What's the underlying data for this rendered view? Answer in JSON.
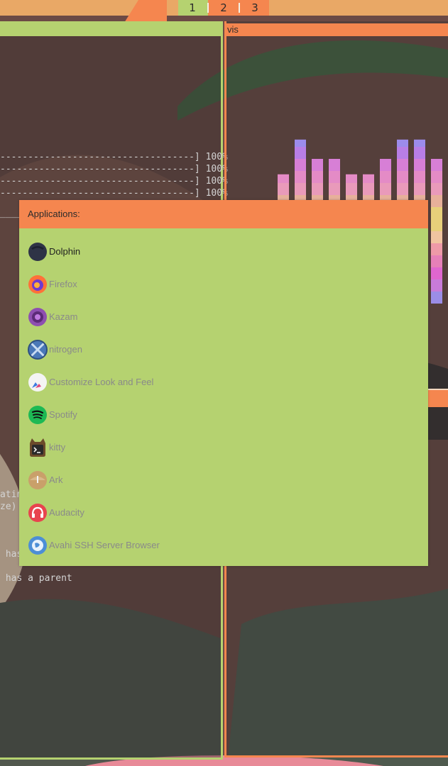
{
  "workspaces": [
    {
      "label": "1",
      "active": true
    },
    {
      "label": "2",
      "active": false
    },
    {
      "label": "3",
      "active": false
    }
  ],
  "right_window": {
    "title": "vis"
  },
  "terminal": {
    "lines": [
      "-----------------------------------] 100%",
      "-----------------------------------] 100%",
      "-----------------------------------] 100%",
      "-----------------------------------] 100%",
      "____",
      "atin",
      "ze)",
      " has",
      " has a parent"
    ]
  },
  "launcher": {
    "header": "Applications:",
    "items": [
      {
        "label": "Dolphin",
        "icon": "dolphin-icon",
        "selected": true
      },
      {
        "label": "Firefox",
        "icon": "firefox-icon",
        "selected": false
      },
      {
        "label": "Kazam",
        "icon": "kazam-icon",
        "selected": false
      },
      {
        "label": "nitrogen",
        "icon": "nitrogen-icon",
        "selected": false
      },
      {
        "label": "Customize Look and Feel",
        "icon": "customize-look-icon",
        "selected": false
      },
      {
        "label": "Spotify",
        "icon": "spotify-icon",
        "selected": false
      },
      {
        "label": "kitty",
        "icon": "kitty-icon",
        "selected": false
      },
      {
        "label": "Ark",
        "icon": "ark-icon",
        "selected": false
      },
      {
        "label": "Audacity",
        "icon": "audacity-icon",
        "selected": false
      },
      {
        "label": "Avahi SSH Server Browser",
        "icon": "avahi-ssh-icon",
        "selected": false
      }
    ]
  },
  "colors": {
    "accent_green": "#b5d270",
    "accent_orange": "#f5864f",
    "topbar": "#e9a866"
  },
  "visualizer": {
    "levels": [
      0.17,
      0.26,
      0.52,
      0.67,
      0.85,
      0.75,
      0.75,
      0.67,
      0.67,
      0.75,
      0.85,
      0.85,
      0.75
    ]
  }
}
